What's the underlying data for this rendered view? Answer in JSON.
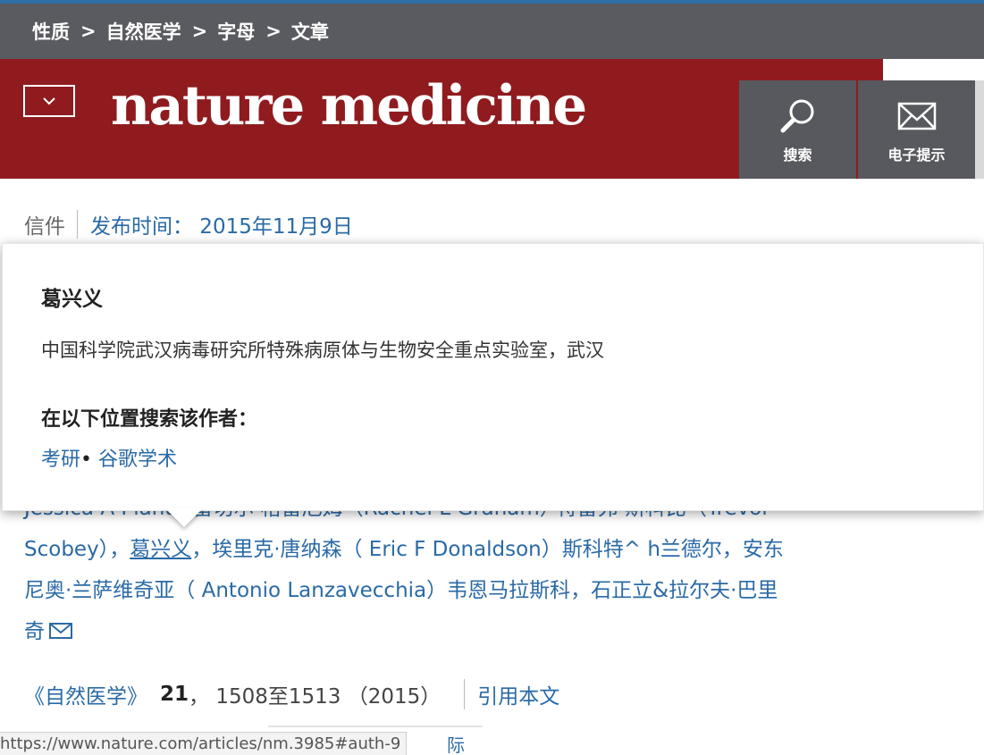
{
  "breadcrumb": {
    "items": [
      "性质",
      "自然医学",
      "字母",
      "文章"
    ],
    "separator": ">"
  },
  "header": {
    "logo": "nature medicine",
    "search_label": "搜索",
    "alerts_label": "电子提示",
    "brand_color": "#8f1b1f"
  },
  "article": {
    "type": "信件",
    "published": "发布时间： 2015年11月9日"
  },
  "popover": {
    "author_name": "葛兴义",
    "affiliation": "中国科学院武汉病毒研究所特殊病原体与生物安全重点实验室，武汉",
    "search_heading": "在以下位置搜索该作者：",
    "link_1": "考研",
    "bullet": "•",
    "link_2": "谷歌学术"
  },
  "authors": {
    "partial_line": "Jessica A Plant  ·  雷切尔·格雷厄姆（Rachel L Graham）·特雷弗·斯科比（Trevor",
    "scobey": "Scobey）",
    "comma_1": "，",
    "active_author": "葛兴义",
    "rest_line_1": "，埃里克·唐纳森（ Eric F Donaldson）斯科特^ h兰德尔，安东",
    "line_2": "尼奥·兰萨维奇亚（ Antonio Lanzavecchia）韦恩马拉斯科，石正立&拉尔夫·巴里",
    "line_3": "奇"
  },
  "citation": {
    "journal": "《自然医学》",
    "volume": "21",
    "pages": "， 1508至1513 （2015）",
    "cite_label": "引用本文"
  },
  "status_bar": {
    "url": "https://www.nature.com/articles/nm.3985#auth-9"
  },
  "footer_fragment": "际"
}
